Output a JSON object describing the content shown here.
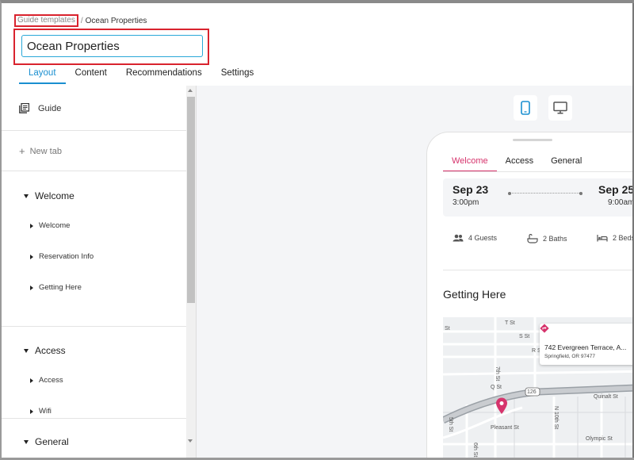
{
  "breadcrumb": {
    "parent": "Guide templates",
    "separator": "/",
    "current": "Ocean Properties"
  },
  "title_input": {
    "value": "Ocean Properties"
  },
  "tabs": [
    {
      "label": "Layout",
      "active": true
    },
    {
      "label": "Content",
      "active": false
    },
    {
      "label": "Recommendations",
      "active": false
    },
    {
      "label": "Settings",
      "active": false
    }
  ],
  "sidebar": {
    "guide_label": "Guide",
    "new_tab_label": "New tab",
    "sections": [
      {
        "title": "Welcome",
        "items": [
          "Welcome",
          "Reservation Info",
          "Getting Here"
        ]
      },
      {
        "title": "Access",
        "items": [
          "Access",
          "Wifi"
        ]
      },
      {
        "title": "General",
        "items": []
      }
    ]
  },
  "device_toggle": {
    "mobile_icon": "smartphone-icon",
    "desktop_icon": "monitor-icon",
    "selected": "mobile"
  },
  "phone_preview": {
    "tabs": [
      {
        "label": "Welcome",
        "active": true
      },
      {
        "label": "Access",
        "active": false
      },
      {
        "label": "General",
        "active": false
      }
    ],
    "checkin": {
      "date": "Sep 23",
      "time": "3:00pm"
    },
    "checkout": {
      "date": "Sep 25",
      "time": "9:00am"
    },
    "amenities": [
      {
        "icon": "guests-icon",
        "label": "4 Guests"
      },
      {
        "icon": "bath-icon",
        "label": "2 Baths"
      },
      {
        "icon": "bed-icon",
        "label": "2 Beds"
      }
    ],
    "section_title": "Getting Here",
    "map": {
      "address": "742 Evergreen Terrace, A...",
      "city": "Springfield, OR 97477",
      "streets": [
        "T St",
        "S St",
        "R St",
        "Q St",
        "7th St",
        "N 10th St",
        "Quinalt St",
        "Olympic St",
        "Pleasant St",
        "5th St",
        "6th St",
        "St"
      ],
      "highway_shield": "126",
      "zoom_in": "+",
      "zoom_out": "−",
      "accent": "#d6336c"
    }
  },
  "colors": {
    "accent_blue": "#1a8fd0",
    "accent_pink": "#d6336c",
    "highlight_red": "#d9232e"
  }
}
